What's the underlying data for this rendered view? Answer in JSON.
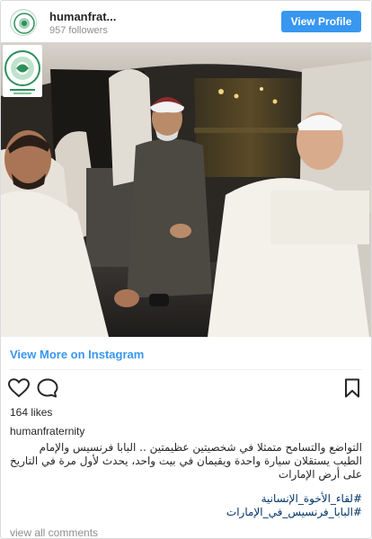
{
  "header": {
    "username": "humanfrat...",
    "followers": "957 followers",
    "view_profile_label": "View Profile"
  },
  "post": {
    "view_more_label": "View More on Instagram",
    "likes": "164 likes",
    "author": "humanfraternity",
    "caption_lines": [
      "التواضع والتسامح متمثلا في شخصيتين عظيمتين .. البابا فرنسيس والإمام",
      "الطيب يستقلان سيارة واحدة ويقيمان في بيت واحد، يحدث لأول مرة في التاريخ",
      "على أرض الإمارات"
    ],
    "hashtags": [
      "#لقاء_الأخوة_الإنسانية",
      "#البابا_فرنسيس_في_الإمارات"
    ],
    "view_comments_label": "view all comments"
  },
  "icons": {
    "like": "heart-icon",
    "comment": "comment-icon",
    "save": "bookmark-icon"
  },
  "colors": {
    "accent": "#3897f0",
    "hashtag": "#003569",
    "muted": "#8e8e8e"
  }
}
